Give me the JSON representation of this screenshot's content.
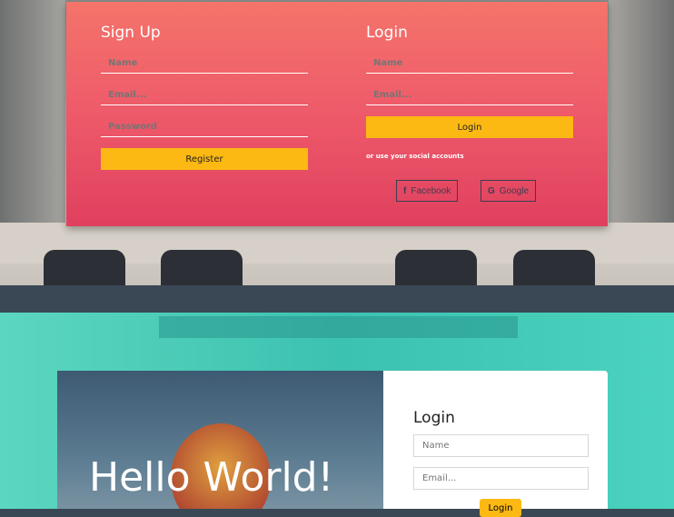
{
  "signup": {
    "title": "Sign Up",
    "name_placeholder": "Name",
    "email_placeholder": "Email...",
    "password_placeholder": "Password",
    "register_label": "Register"
  },
  "login": {
    "title": "Login",
    "name_placeholder": "Name",
    "email_placeholder": "Email...",
    "login_label": "Login",
    "social_note": "or use your social accounts",
    "facebook_label": "Facebook",
    "google_label": "Google"
  },
  "hero": {
    "title": "Hello World!"
  },
  "login2": {
    "title": "Login",
    "name_placeholder": "Name",
    "email_placeholder": "Email...",
    "login_label": "Login"
  },
  "colors": {
    "accent": "#fdb913",
    "card_gradient": "#ee5a6a",
    "teal": "#3cc2b0",
    "band": "#3a4856"
  }
}
